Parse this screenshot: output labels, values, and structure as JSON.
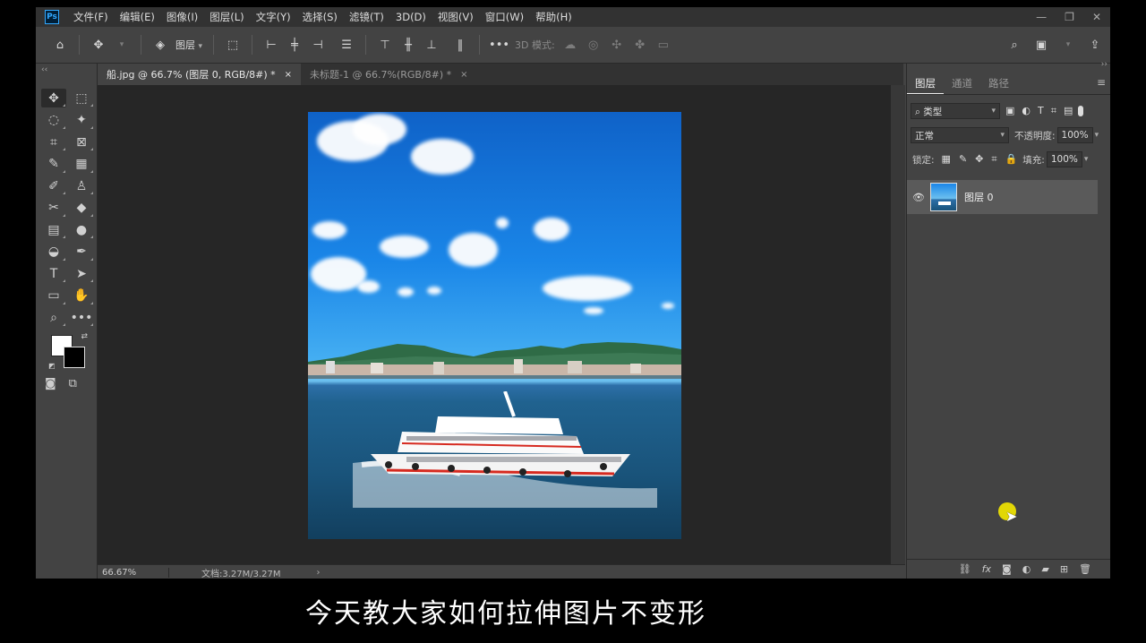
{
  "app": {
    "logo": "Ps"
  },
  "menu": [
    "文件(F)",
    "编辑(E)",
    "图像(I)",
    "图层(L)",
    "文字(Y)",
    "选择(S)",
    "滤镜(T)",
    "3D(D)",
    "视图(V)",
    "窗口(W)",
    "帮助(H)"
  ],
  "window_controls": {
    "minimize": "—",
    "restore": "❐",
    "close": "✕"
  },
  "options": {
    "auto_select_target": "图层",
    "mode_3d_label": "3D 模式:"
  },
  "document_tabs": [
    {
      "label": "船.jpg @ 66.7% (图层 0, RGB/8#) *",
      "close": "×"
    },
    {
      "label": "未标题-1 @ 66.7%(RGB/8#) *",
      "close": "×"
    }
  ],
  "status": {
    "zoom": "66.67%",
    "doc_size": "文档:3.27M/3.27M",
    "arrow": "›"
  },
  "panel": {
    "tabs": [
      "图层",
      "通道",
      "路径"
    ],
    "filter_label": "类型",
    "blend_mode": "正常",
    "opacity_label": "不透明度:",
    "opacity_value": "100%",
    "lock_label": "锁定:",
    "fill_label": "填充:",
    "fill_value": "100%",
    "layers": [
      {
        "name": "图层 0",
        "visible": true
      }
    ]
  },
  "subtitle": "今天教大家如何拉伸图片不变形",
  "colors": {
    "foreground": "#ffffff",
    "background": "#000000",
    "cursor_highlight": "#f4e800"
  }
}
